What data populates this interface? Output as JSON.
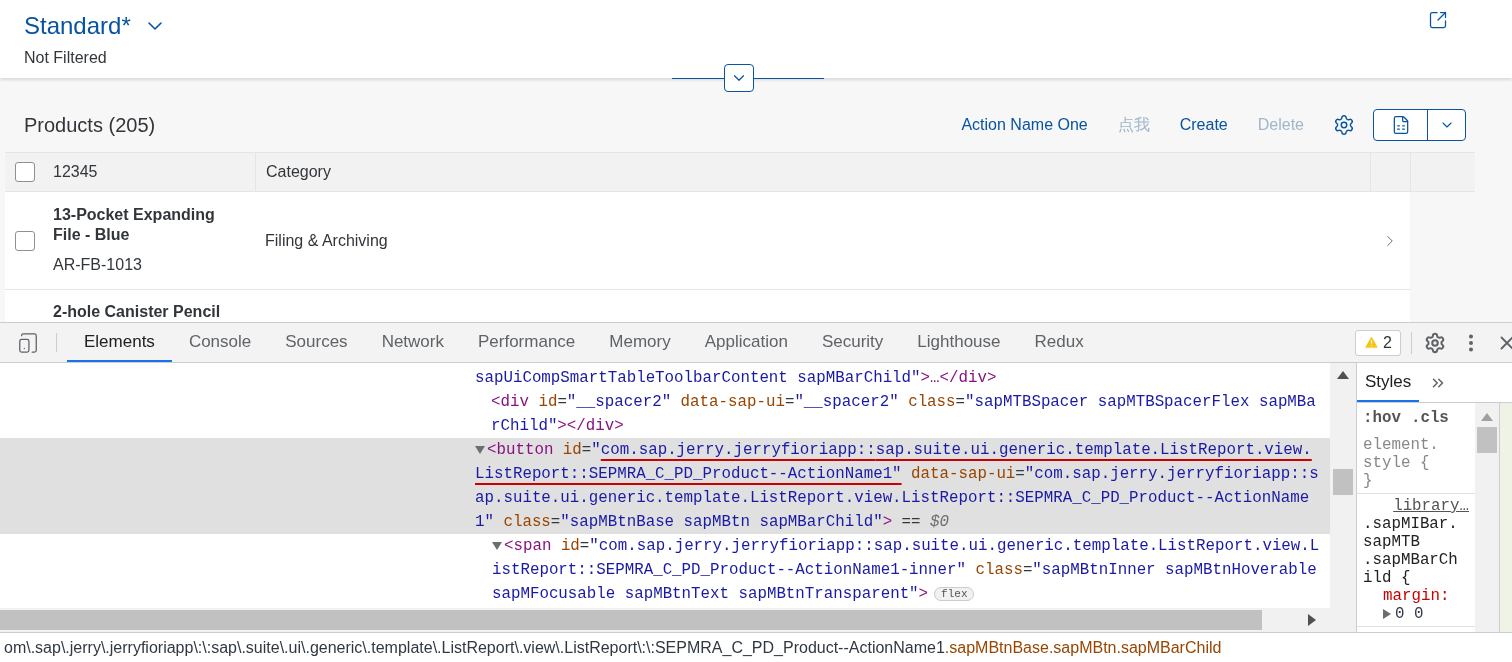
{
  "header": {
    "variant": "Standard*",
    "filter_status": "Not Filtered"
  },
  "toolbar": {
    "title": "Products (205)",
    "actions": [
      {
        "label": "Action Name One",
        "disabled": false
      },
      {
        "label": "点我",
        "disabled": true
      },
      {
        "label": "Create",
        "disabled": false
      },
      {
        "label": "Delete",
        "disabled": true
      }
    ]
  },
  "table": {
    "columns": [
      "12345",
      "Category"
    ],
    "select_all_checked": false,
    "rows": [
      {
        "name": "13-Pocket Expanding File - Blue",
        "id": "AR-FB-1013",
        "category": "Filing & Archiving",
        "checked": false
      },
      {
        "name": "2-hole Canister Pencil"
      }
    ]
  },
  "devtools": {
    "tabs": [
      {
        "label": "Elements",
        "selected": true
      },
      {
        "label": "Console",
        "selected": false
      },
      {
        "label": "Sources",
        "selected": false
      },
      {
        "label": "Network",
        "selected": false
      },
      {
        "label": "Performance",
        "selected": false
      },
      {
        "label": "Memory",
        "selected": false
      },
      {
        "label": "Application",
        "selected": false
      },
      {
        "label": "Security",
        "selected": false
      },
      {
        "label": "Lighthouse",
        "selected": false
      },
      {
        "label": "Redux",
        "selected": false
      }
    ],
    "warnings": "2",
    "elements": [
      {
        "kind": "tail",
        "lines": [
          [
            {
              "kind": "value",
              "text": "sapUiCompSmartTableToolbarContent sapMBarChild\""
            },
            {
              "kind": "tag",
              "text": ">…</div>"
            }
          ]
        ]
      },
      {
        "kind": "leaf",
        "lines": [
          [
            {
              "kind": "tag",
              "text": "<div"
            },
            {
              "kind": "attr",
              "text": " id"
            },
            {
              "kind": "punct",
              "text": "="
            },
            {
              "kind": "value",
              "text": "\"__spacer2\""
            },
            {
              "kind": "attr",
              "text": " data-sap-ui"
            },
            {
              "kind": "punct",
              "text": "="
            },
            {
              "kind": "value",
              "text": "\"__spacer2\""
            },
            {
              "kind": "attr",
              "text": " class"
            },
            {
              "kind": "punct",
              "text": "="
            },
            {
              "kind": "value",
              "text": "\"sapMTBSpacer sapMTBSpacerFlex sapMBa"
            }
          ],
          [
            {
              "kind": "value",
              "text": "rChild\""
            },
            {
              "kind": "tag",
              "text": "></div>"
            }
          ]
        ]
      },
      {
        "kind": "element",
        "expanded": true,
        "selected": true,
        "lines": [
          [
            {
              "kind": "tag",
              "text": "<button"
            },
            {
              "kind": "attr",
              "text": " id"
            },
            {
              "kind": "punct",
              "text": "="
            },
            {
              "kind": "value",
              "text": "\""
            },
            {
              "kind": "mark",
              "text": "com.sap.jerry.jerryfioriapp::"
            },
            {
              "kind": "mark",
              "text": "sap.suite.ui.generic.template.ListReport.view."
            }
          ],
          [
            {
              "kind": "mark",
              "text": "ListReport::SEPMRA_C_PD_Product--ActionName1\""
            },
            {
              "kind": "attr",
              "text": " data-sap-ui"
            },
            {
              "kind": "punct",
              "text": "="
            },
            {
              "kind": "value",
              "text": "\"com.sap.jerry.jerryfioriapp::s"
            }
          ],
          [
            {
              "kind": "value",
              "text": "ap.suite.ui.generic.template.ListReport.view.ListReport::SEPMRA_C_PD_Product--ActionName"
            }
          ],
          [
            {
              "kind": "value",
              "text": "1\""
            },
            {
              "kind": "attr",
              "text": " class"
            },
            {
              "kind": "punct",
              "text": "="
            },
            {
              "kind": "value",
              "text": "\"sapMBtnBase sapMBtn sapMBarChild\""
            },
            {
              "kind": "tag",
              "text": ">"
            },
            {
              "kind": "punct",
              "text": " == "
            },
            {
              "kind": "ref",
              "text": "$0"
            }
          ]
        ],
        "children": [
          {
            "kind": "element",
            "expanded": true,
            "selected": false,
            "lines": [
              [
                {
                  "kind": "tag",
                  "text": "<span"
                },
                {
                  "kind": "attr",
                  "text": " id"
                },
                {
                  "kind": "punct",
                  "text": "="
                },
                {
                  "kind": "value",
                  "text": "\"com.sap.jerry.jerryfioriapp::sap.suite.ui.generic.template.ListReport.view.L"
                }
              ],
              [
                {
                  "kind": "value",
                  "text": "istReport::SEPMRA_C_PD_Product--ActionName1-inner\""
                },
                {
                  "kind": "attr",
                  "text": " class"
                },
                {
                  "kind": "punct",
                  "text": "="
                },
                {
                  "kind": "value",
                  "text": "\"sapMBtnInner sapMBtnHoverable"
                }
              ],
              [
                {
                  "kind": "value",
                  "text": "sapMFocusable sapMBtnText sapMBtnTransparent\""
                },
                {
                  "kind": "tag",
                  "text": ">"
                },
                {
                  "kind": "badge",
                  "text": "flex"
                }
              ]
            ]
          }
        ]
      }
    ]
  },
  "styles": {
    "tabs": [
      {
        "label": "Styles",
        "selected": true
      }
    ],
    "filters": [
      ":hov",
      ".cls"
    ],
    "rules": [
      {
        "lines": [
          "element.",
          "style {",
          "}"
        ]
      },
      {
        "source": "library…",
        "lines": [
          ".sapMIBar.",
          "sapMTB",
          ".sapMBarCh",
          "ild {"
        ],
        "property": "margin:",
        "value": "0 0"
      }
    ]
  },
  "breadcrumb": {
    "path": "om\\.sap\\.jerry\\.jerryfioriapp\\:\\:sap\\.suite\\.ui\\.generic\\.template\\.ListReport\\.view\\.ListReport\\:\\:SEPMRA_C_PD_Product--ActionName1",
    "classes": ".sapMBtnBase.sapMBtn.sapMBarChild"
  }
}
